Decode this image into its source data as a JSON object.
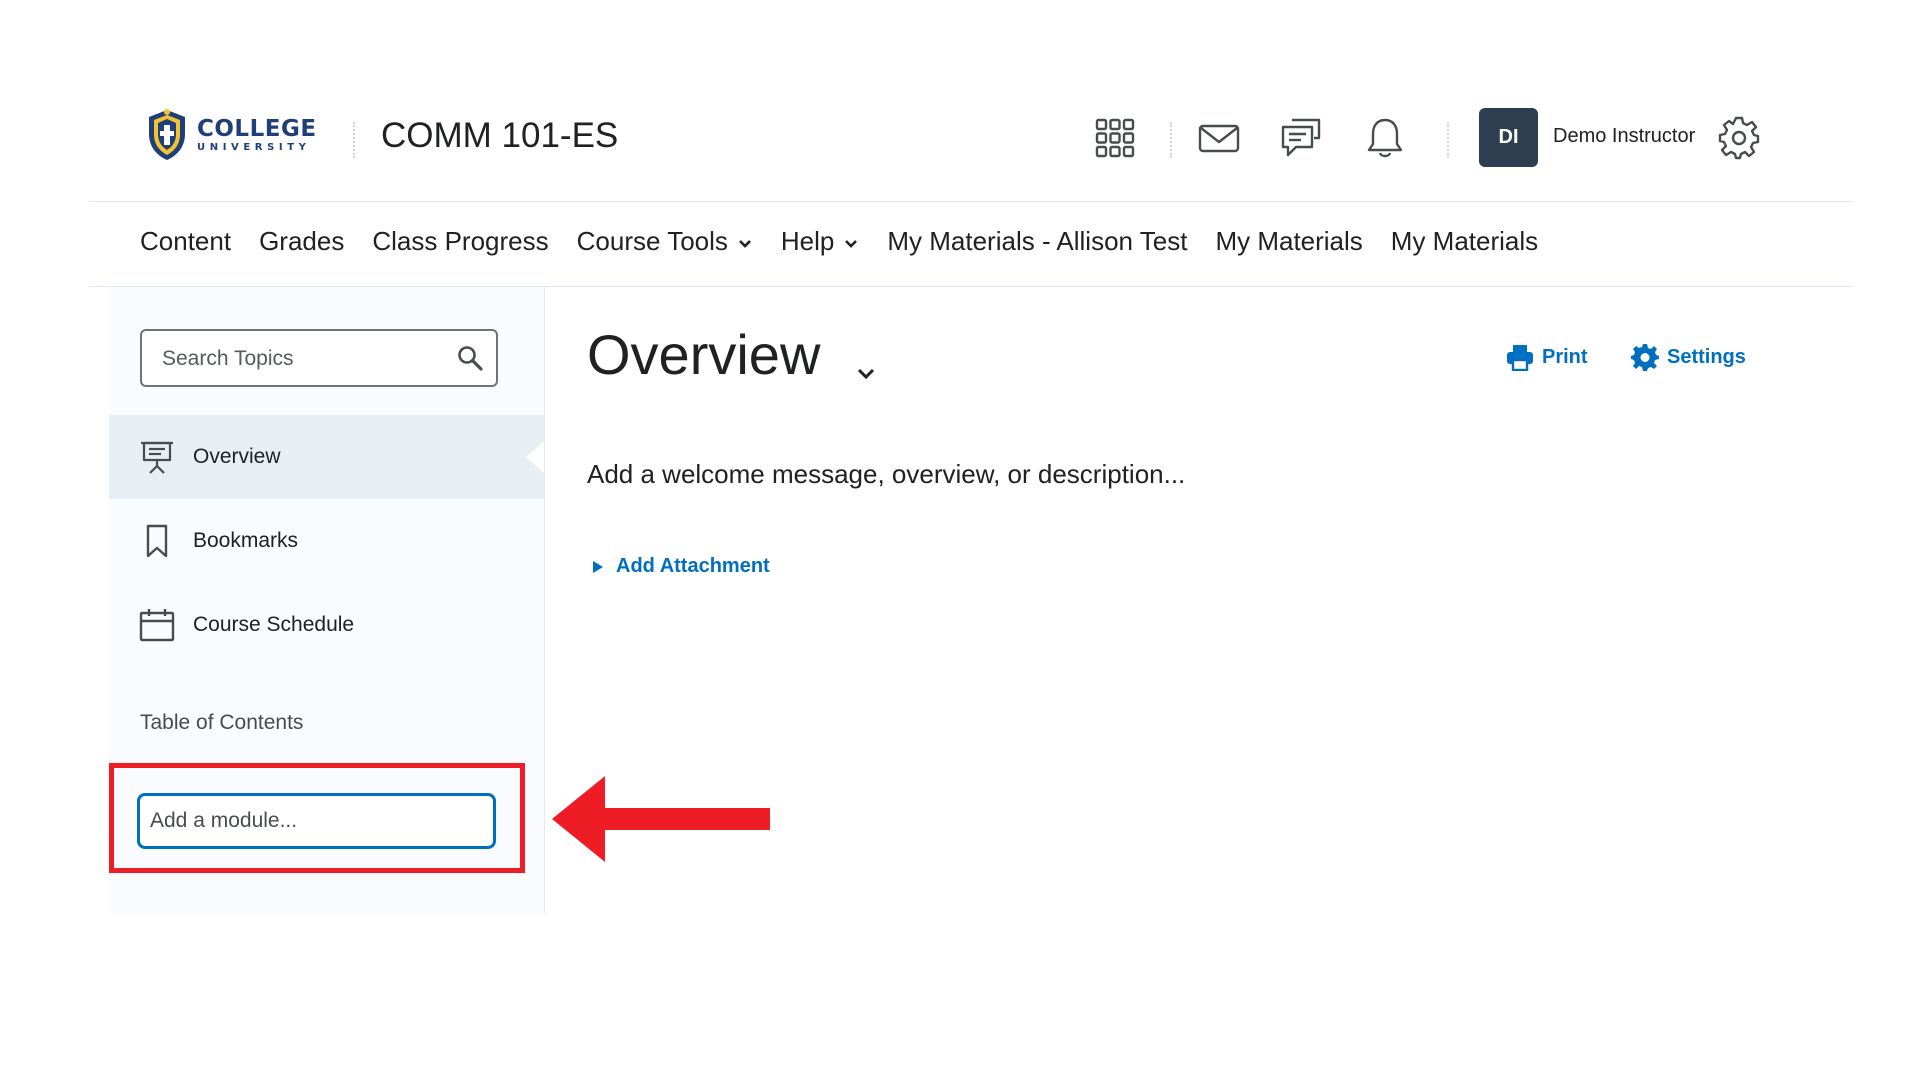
{
  "header": {
    "logo": {
      "line1": "COLLEGE",
      "line2": "UNIVERSITY"
    },
    "course_title": "COMM 101-ES",
    "icons": [
      "waffle-grid-icon",
      "mail-icon",
      "chat-icon",
      "bell-icon",
      "gear-icon"
    ],
    "user": {
      "initials": "DI",
      "name": "Demo Instructor"
    }
  },
  "nav": {
    "items": [
      {
        "label": "Content"
      },
      {
        "label": "Grades"
      },
      {
        "label": "Class Progress"
      },
      {
        "label": "Course Tools"
      },
      {
        "label": "Help"
      },
      {
        "label": "My Materials - Allison Test"
      },
      {
        "label": "My Materials"
      },
      {
        "label": "My Materials"
      }
    ]
  },
  "sidebar": {
    "search_placeholder": "Search Topics",
    "topics": [
      {
        "label": "Overview",
        "icon": "presentation-icon",
        "active": true
      },
      {
        "label": "Bookmarks",
        "icon": "bookmark-icon",
        "active": false
      },
      {
        "label": "Course Schedule",
        "icon": "calendar-icon",
        "active": false
      }
    ],
    "toc_heading": "Table of Contents",
    "add_module_placeholder": "Add a module..."
  },
  "main": {
    "title": "Overview",
    "print_label": "Print",
    "settings_label": "Settings",
    "welcome_text": "Add a welcome message, overview, or description...",
    "add_attachment_label": "Add Attachment"
  },
  "colors": {
    "link": "#006fbf",
    "avatar_bg": "#2c3e50",
    "annotation": "#ee1c25",
    "active_bg": "#e9eef5"
  }
}
